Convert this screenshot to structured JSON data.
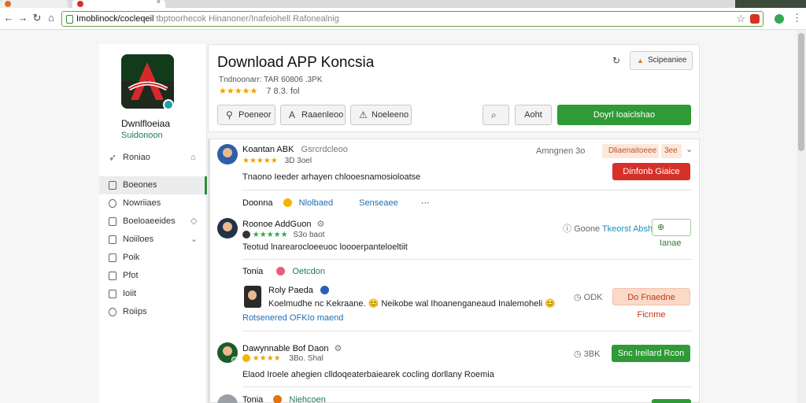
{
  "browser": {
    "url_host": "Imoblinock/cocleqeil",
    "url_path": "tbptoorhecok Hinanoner/Inafeiohell Rafonealnig"
  },
  "app": {
    "name": "Dwnlfloeiaa",
    "subtitle": "Suidonoon"
  },
  "sidebar": {
    "items": [
      {
        "label": "Roniao",
        "icon": "cursor-icon"
      },
      {
        "label": "Boeones",
        "icon": "book-icon"
      },
      {
        "label": "Nowriiaes",
        "icon": "clock-icon"
      },
      {
        "label": "Boeloaeeides",
        "icon": "list-icon"
      },
      {
        "label": "Noiiloes",
        "icon": "folder-icon"
      },
      {
        "label": "Poik",
        "icon": "page-icon"
      },
      {
        "label": "Pfot",
        "icon": "photo-icon"
      },
      {
        "label": "Ioiit",
        "icon": "doc-icon"
      },
      {
        "label": "Roiips",
        "icon": "info-icon"
      }
    ]
  },
  "header": {
    "title": "Download APP Koncsia",
    "meta": "Tndnoonarr: TAR 60806 .3PK",
    "stars": "★★★★★",
    "rating": "7 8.3. fol",
    "buttons": [
      "Poeneor",
      "Raaenleoo",
      "Noeleeno",
      "Aoht"
    ],
    "download": "Doyrl Ioaiclshao",
    "sponsor": "Scipeaniee"
  },
  "feed": {
    "post1": {
      "user": "Koantan ABK",
      "tag": "Gsrcrdcleoo",
      "stars": "★★★★★",
      "score": "3D 3oel",
      "time": "Amngnen 3o",
      "chip1": "Dliaenaitoeee",
      "chip2": "3ee",
      "report": "Dinfonb Giaice",
      "text": "Tnaono Ieeder arhayen chlooesnamosioloatse",
      "reply_label": "Doonna",
      "reply_name": "Nlolbaed",
      "reply_link": "Senseaee"
    },
    "post2": {
      "user": "Roonoe AddGuon",
      "stars": "★★★★★",
      "score": "S3o baot",
      "count": "Goone",
      "count_link": "Tkeorst Abshi",
      "follow": "Ianae",
      "text": "Teotud lnarearocloeeuoc loooerpanteloeltiit",
      "reply_label": "Tonia",
      "reply_name": "Oetcdon",
      "nested_user": "Roly Paeda",
      "nested_text": "Koelmudhe nc Kekraane. 😊 Neikobe wal Ihoanenganeaud Inalemoheli 😊",
      "nested_link": "Rotsenered OFKIo maend",
      "nested_count": "ODK",
      "nested_btn": "Do Fnaedne Ficnme"
    },
    "post3": {
      "user": "Dawynnable Bof Daon",
      "stars": "★★★★",
      "score": "3Bo. Shal",
      "count": "3BK",
      "btn": "Snc Ireilard Rcon",
      "text": "Elaod Iroele ahegien clldoqeaterbaiearek cocling dorllany Roemia"
    },
    "post4": {
      "label": "Tonia",
      "name": "Niehcoen"
    }
  },
  "colors": {
    "accent_green": "#2f9a36",
    "danger_red": "#d7302a",
    "star": "#f2a100",
    "link_blue": "#1f6fb5"
  }
}
